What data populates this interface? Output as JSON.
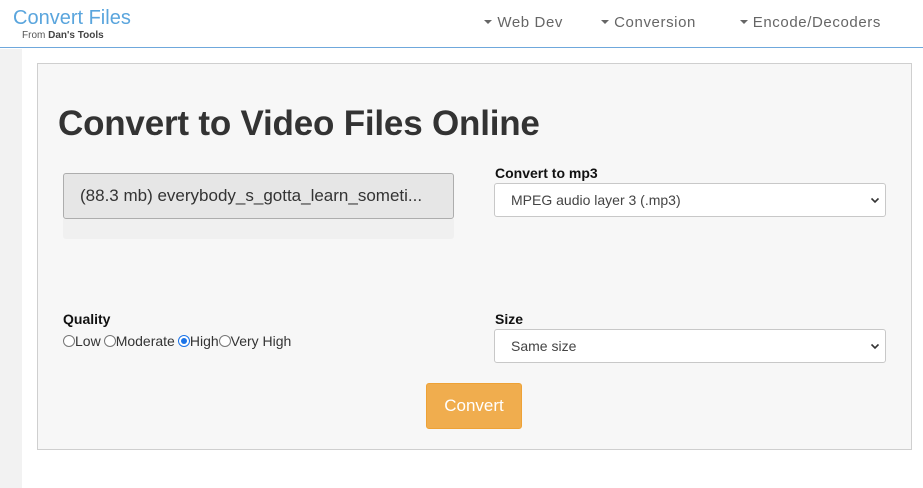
{
  "brand": {
    "title": "Convert Files",
    "sub_prefix": "From",
    "sub_name": "Dan's Tools"
  },
  "nav": [
    {
      "label": "Web Dev"
    },
    {
      "label": "Conversion"
    },
    {
      "label": "Encode/Decoders"
    }
  ],
  "main": {
    "heading": "Convert to Video Files Online",
    "file_button": "(88.3 mb) everybody_s_gotta_learn_someti...",
    "convert_to": {
      "label": "Convert to mp3",
      "selected": "MPEG audio layer 3 (.mp3)"
    },
    "quality": {
      "label": "Quality",
      "options": [
        "Low",
        "Moderate",
        "High",
        "Very High"
      ],
      "selected": "High"
    },
    "size": {
      "label": "Size",
      "selected": "Same size"
    },
    "convert_button": "Convert"
  },
  "colors": {
    "brand": "#5aa5dd",
    "accent_button": "#f0ad4e",
    "radio_checked": "#1a73e8"
  }
}
